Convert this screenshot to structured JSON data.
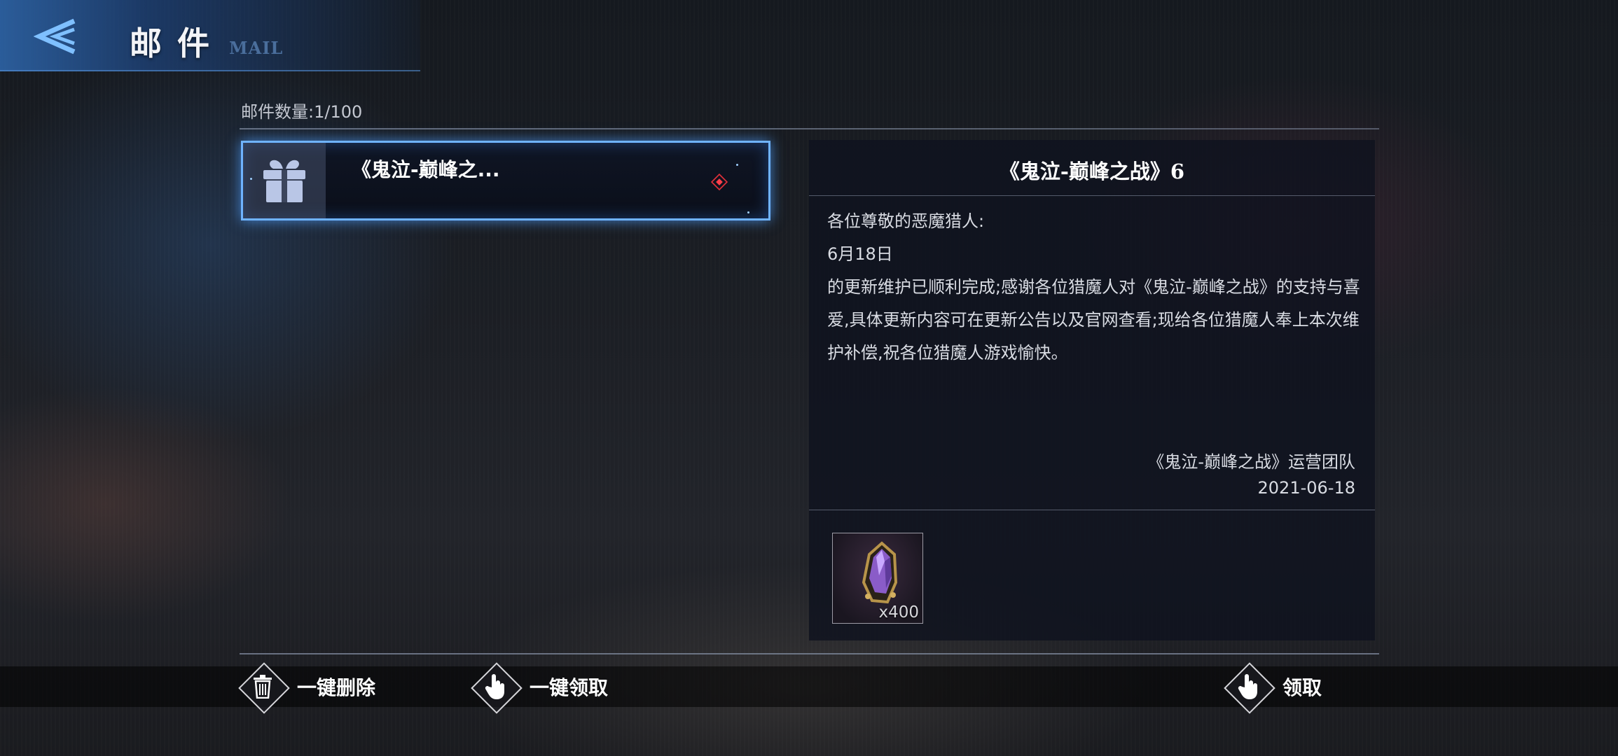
{
  "header": {
    "title": "邮件",
    "subtitle": "MAIL"
  },
  "mail_count": {
    "text": "邮件数量:1/100"
  },
  "mail_list": [
    {
      "title": "《鬼泣-巅峰之...",
      "icon": "gift-icon",
      "unread": true
    }
  ],
  "detail": {
    "title": "《鬼泣-巅峰之战》6",
    "greeting": "各位尊敬的恶魔猎人:",
    "date_line": "6月18日",
    "body": "的更新维护已顺利完成;感谢各位猎魔人对《鬼泣-巅峰之战》的支持与喜爱,具体更新内容可在更新公告以及官网查看;现给各位猎魔人奉上本次维护补偿,祝各位猎魔人游戏愉快。",
    "signature": "《鬼泣-巅峰之战》运营团队",
    "date": "2021-06-18"
  },
  "reward": {
    "icon": "purple-crystal-icon",
    "quantity": "x400"
  },
  "actions": {
    "delete_all": "一键删除",
    "claim_all": "一键领取",
    "claim": "领取"
  },
  "colors": {
    "accent": "#6fb3ff",
    "header": "#2c60a0",
    "unread": "#e0303a"
  }
}
